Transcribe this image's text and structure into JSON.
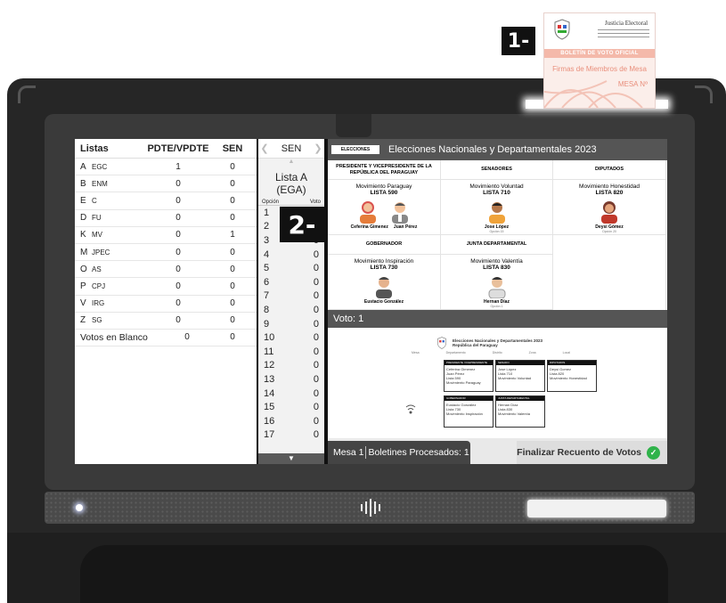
{
  "markers": {
    "m1": "1-",
    "m2": "2-"
  },
  "ballot": {
    "org": "Justicia Electoral",
    "band": "BOLETÍN DE VOTO OFICIAL",
    "firmas": "Firmas de Miembros de Mesa",
    "mesa": "MESA Nº"
  },
  "lists_panel": {
    "headers": [
      "Listas",
      "PDTE/VPDTE",
      "SEN"
    ],
    "rows": [
      {
        "key": "A",
        "name": "EGC",
        "pdte": "1",
        "sen": "0"
      },
      {
        "key": "B",
        "name": "ENM",
        "pdte": "0",
        "sen": "0"
      },
      {
        "key": "E",
        "name": "C",
        "pdte": "0",
        "sen": "0"
      },
      {
        "key": "D",
        "name": "FU",
        "pdte": "0",
        "sen": "0"
      },
      {
        "key": "K",
        "name": "MV",
        "pdte": "0",
        "sen": "1"
      },
      {
        "key": "M",
        "name": "JPEC",
        "pdte": "0",
        "sen": "0"
      },
      {
        "key": "O",
        "name": "AS",
        "pdte": "0",
        "sen": "0"
      },
      {
        "key": "P",
        "name": "CPJ",
        "pdte": "0",
        "sen": "0"
      },
      {
        "key": "V",
        "name": "IRG",
        "pdte": "0",
        "sen": "0"
      },
      {
        "key": "Z",
        "name": "SG",
        "pdte": "0",
        "sen": "0"
      }
    ],
    "blank": {
      "label": "Votos en Blanco",
      "pdte": "0",
      "sen": "0"
    }
  },
  "mid_panel": {
    "tab": "SEN",
    "title_line1": "Lista A",
    "title_line2": "(EGA)",
    "col_opcion": "Opción",
    "col_voto": "Voto",
    "options": [
      {
        "n": "1",
        "v": ""
      },
      {
        "n": "2",
        "v": ""
      },
      {
        "n": "3",
        "v": "0"
      },
      {
        "n": "4",
        "v": "0"
      },
      {
        "n": "5",
        "v": "0"
      },
      {
        "n": "6",
        "v": "0"
      },
      {
        "n": "7",
        "v": "0"
      },
      {
        "n": "8",
        "v": "0"
      },
      {
        "n": "9",
        "v": "0"
      },
      {
        "n": "10",
        "v": "0"
      },
      {
        "n": "11",
        "v": "0"
      },
      {
        "n": "12",
        "v": "0"
      },
      {
        "n": "13",
        "v": "0"
      },
      {
        "n": "14",
        "v": "0"
      },
      {
        "n": "15",
        "v": "0"
      },
      {
        "n": "16",
        "v": "0"
      },
      {
        "n": "17",
        "v": "0"
      }
    ]
  },
  "right_panel": {
    "logo": "ELECCIONES",
    "title": "Elecciones Nacionales y Departamentales 2023",
    "cells": {
      "pres": {
        "head": "PRESIDENTE Y VICEPRESIDENTE DE LA REPÚBLICA DEL PARAGUAY",
        "party": "Movimiento Paraguay",
        "lista": "LISTA 590",
        "c1": "Ceferina Gimenez",
        "c2": "Juan Pérez"
      },
      "sen": {
        "head": "SENADORES",
        "party": "Movimiento Voluntad",
        "lista": "LISTA 710",
        "c1": "Jose López",
        "op": "Opción 15"
      },
      "dip": {
        "head": "DIPUTADOS",
        "party": "Movimiento Honestidad",
        "lista": "LISTA 820",
        "c1": "Deysi Gómez",
        "op": "Opción 20"
      },
      "gob": {
        "head": "GOBERNADOR",
        "party": "Movimiento Inspiración",
        "lista": "LISTA 730",
        "c1": "Eustacio González"
      },
      "jun": {
        "head": "JUNTA DEPARTAMENTAL",
        "party": "Movimiento Valentía",
        "lista": "LISTA 830",
        "c1": "Hernan Díaz",
        "op": "Opción 1"
      }
    },
    "voto": "Voto: 1",
    "receipt": {
      "title1": "Elecciones Nacionales y Departamentales 2023",
      "title2": "República del Paraguay",
      "fields": [
        "Mesa",
        "Departamento",
        "Distrito",
        "Zona",
        "Local"
      ],
      "boxes": [
        {
          "h": "PRESIDENTE VICEPRESIDENTE",
          "l1": "Ceferina Gimenez",
          "l2": "Juan Pérez",
          "l3": "Lista 590",
          "l4": "Movimiento Paraguay"
        },
        {
          "h": "SENADO",
          "l1": "Jose López",
          "l2": "",
          "l3": "Lista 710",
          "l4": "Movimiento Voluntad"
        },
        {
          "h": "DIPUTADOS",
          "l1": "Deysi Gomez",
          "l2": "",
          "l3": "Lista 820",
          "l4": "Movimiento Honestidad"
        },
        {
          "h": "GOBERNADOR",
          "l1": "Eustacio González",
          "l2": "",
          "l3": "Lista 730",
          "l4": "Movimiento Inspiración"
        },
        {
          "h": "JUNTA DEPARTAMENTAL",
          "l1": "Hernan Díaz",
          "l2": "",
          "l3": "Lista 830",
          "l4": "Movimiento Valentía"
        }
      ]
    },
    "mesa_label": "Mesa 1",
    "processed": "Boletines Procesados: 1",
    "finalizar": "Finalizar Recuento de Votos"
  },
  "colors": {
    "accent_green": "#2fb34a",
    "header_gray": "#555555"
  },
  "icons": [
    "chevron-left-icon",
    "chevron-right-icon",
    "chevron-up-icon",
    "chevron-down-icon",
    "check-icon",
    "nfc-icon",
    "justice-logo-icon"
  ]
}
